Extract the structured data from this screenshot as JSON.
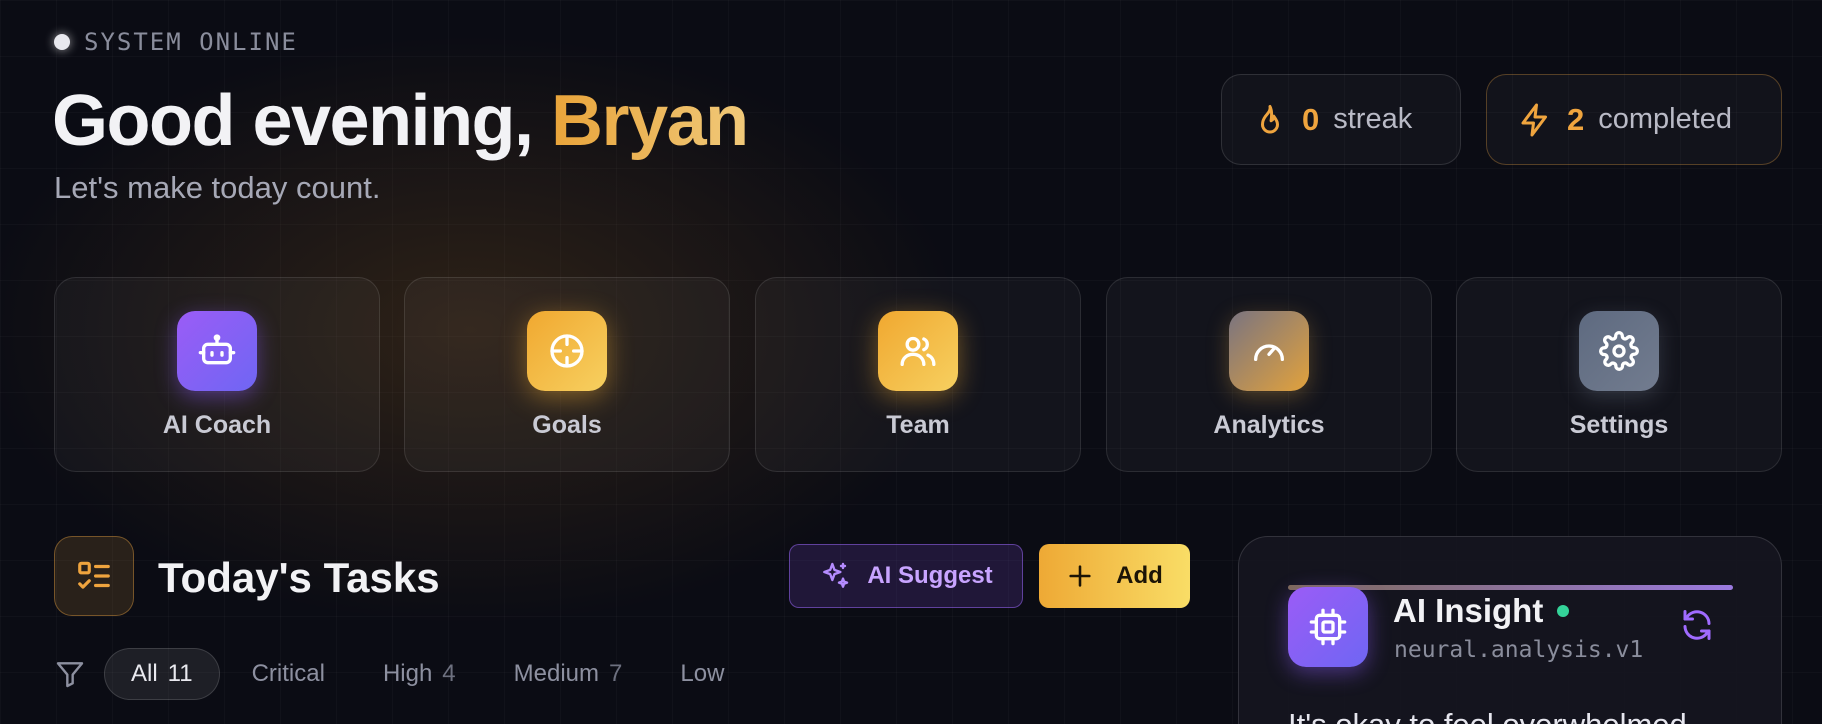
{
  "header": {
    "status": "SYSTEM ONLINE",
    "greeting_prefix": "Good evening,",
    "greeting_name": "Bryan",
    "subtitle": "Let's make today count."
  },
  "stats": {
    "streak": {
      "value": "0",
      "label": "streak",
      "icon": "flame-icon"
    },
    "completed": {
      "value": "2",
      "label": "completed",
      "icon": "lightning-icon"
    }
  },
  "quick_actions": [
    {
      "label": "AI Coach",
      "icon": "robot-icon"
    },
    {
      "label": "Goals",
      "icon": "target-icon"
    },
    {
      "label": "Team",
      "icon": "users-icon"
    },
    {
      "label": "Analytics",
      "icon": "gauge-icon"
    },
    {
      "label": "Settings",
      "icon": "gear-icon"
    }
  ],
  "tasks": {
    "title": "Today's Tasks",
    "ai_suggest_label": "AI Suggest",
    "add_label": "Add",
    "filters": [
      {
        "label": "All",
        "count": "11",
        "active": true
      },
      {
        "label": "Critical",
        "count": ""
      },
      {
        "label": "High",
        "count": "4"
      },
      {
        "label": "Medium",
        "count": "7"
      },
      {
        "label": "Low",
        "count": ""
      }
    ]
  },
  "insight": {
    "title": "AI Insight",
    "subtitle": "neural.analysis.v1",
    "text": "It's okay to feel overwhelmed"
  },
  "colors": {
    "accent_gold": "#efa43e",
    "accent_purple": "#8b5cf6",
    "background": "#0b0c14",
    "online_green": "#34d399"
  }
}
